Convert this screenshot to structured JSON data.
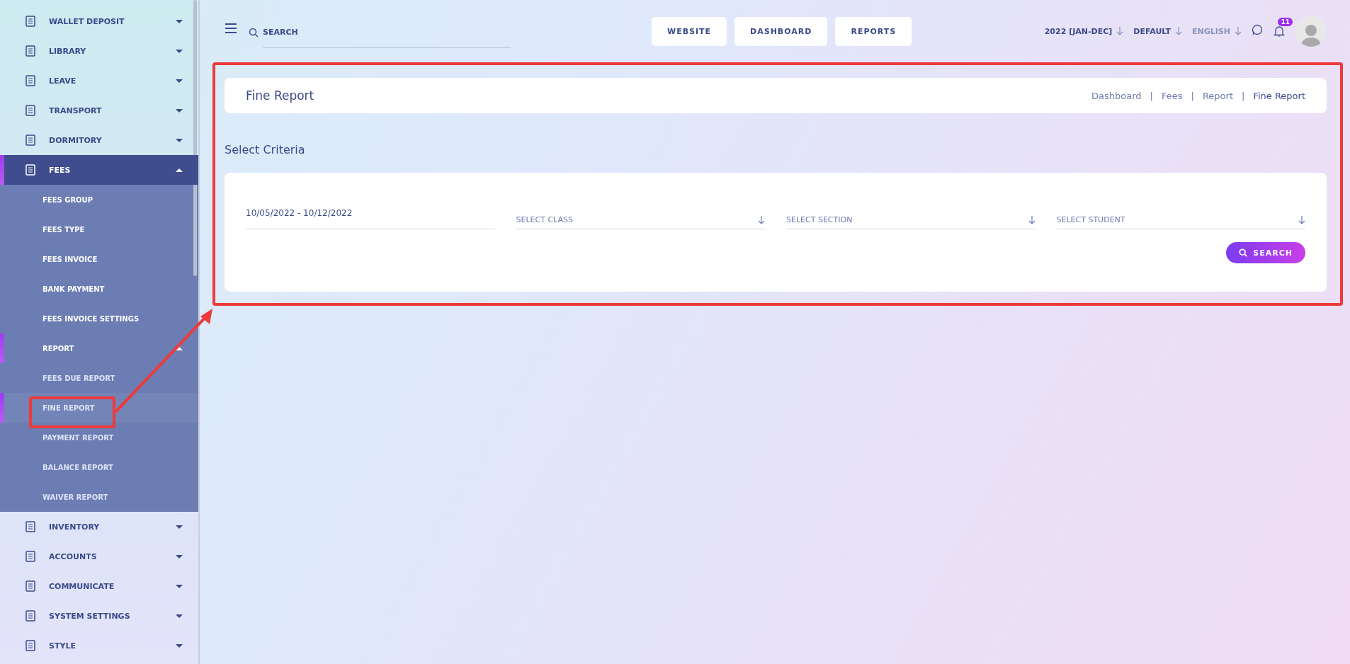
{
  "sidebar": {
    "items": [
      {
        "label": "WALLET DEPOSIT",
        "expanded": false
      },
      {
        "label": "LIBRARY",
        "expanded": false
      },
      {
        "label": "LEAVE",
        "expanded": false
      },
      {
        "label": "TRANSPORT",
        "expanded": false
      },
      {
        "label": "DORMITORY",
        "expanded": false
      },
      {
        "label": "FEES",
        "expanded": true,
        "children": [
          {
            "label": "FEES GROUP",
            "selected": false
          },
          {
            "label": "FEES TYPE",
            "selected": false
          },
          {
            "label": "FEES INVOICE",
            "selected": false
          },
          {
            "label": "BANK PAYMENT",
            "selected": false
          },
          {
            "label": "FEES INVOICE SETTINGS",
            "selected": false
          },
          {
            "label": "REPORT",
            "selected": false,
            "expanded": true,
            "children": [
              {
                "label": "FEES DUE REPORT",
                "selected": false
              },
              {
                "label": "FINE REPORT",
                "selected": true
              },
              {
                "label": "PAYMENT REPORT",
                "selected": false
              },
              {
                "label": "BALANCE REPORT",
                "selected": false
              },
              {
                "label": "WAIVER REPORT",
                "selected": false
              }
            ]
          }
        ]
      },
      {
        "label": "INVENTORY",
        "expanded": false
      },
      {
        "label": "ACCOUNTS",
        "expanded": false
      },
      {
        "label": "COMMUNICATE",
        "expanded": false
      },
      {
        "label": "SYSTEM SETTINGS",
        "expanded": false
      },
      {
        "label": "STYLE",
        "expanded": false
      }
    ]
  },
  "header": {
    "search": {
      "placeholder": "SEARCH"
    },
    "buttons": [
      "WEBSITE",
      "DASHBOARD",
      "REPORTS"
    ],
    "dropdowns": [
      {
        "label": "2022 [JAN-DEC]"
      },
      {
        "label": "DEFAULT"
      },
      {
        "label": "ENGLISH"
      }
    ],
    "notifications": {
      "count": "11"
    }
  },
  "page_title": "Fine Report",
  "breadcrumbs": {
    "separator": "|",
    "items": [
      "Dashboard",
      "Fees",
      "Report",
      "Fine Report"
    ]
  },
  "section_title": "Select Criteria",
  "criteria": {
    "fields": [
      {
        "kind": "date",
        "value": "10/05/2022 - 10/12/2022"
      },
      {
        "kind": "select",
        "placeholder": "SELECT CLASS"
      },
      {
        "kind": "select",
        "placeholder": "SELECT SECTION"
      },
      {
        "kind": "select",
        "placeholder": "SELECT STUDENT"
      }
    ],
    "button": "SEARCH"
  }
}
